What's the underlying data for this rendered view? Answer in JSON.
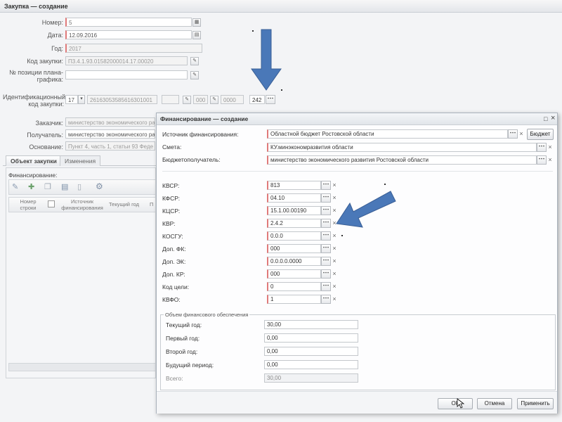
{
  "main": {
    "title": "Закупка — создание",
    "number_label": "Номер:",
    "number_value": "5",
    "date_label": "Дата:",
    "date_value": "12.09.2016",
    "year_label": "Год:",
    "year_value": "2017",
    "code_label": "Код закупки:",
    "code_value": "П3.4.1.93.01582000014.17.00020",
    "plan_pos_label_1": "№ позиции плана-",
    "plan_pos_label_2": "графика:",
    "plan_pos_value": "",
    "ident_label_1": "Идентификационный",
    "ident_label_2": "код закупки:",
    "ident_year": "17",
    "ident_code": "26163053585616301001",
    "ident_part_1": "000",
    "ident_part_2": "0000",
    "ident_part_3": "242",
    "customer_label": "Заказчик:",
    "customer_value": "министерство экономического ра",
    "recipient_label": "Получатель:",
    "recipient_value": "министерство экономического ра",
    "basis_label": "Основание:",
    "basis_value": "Пункт 4, часть 1, статьи 93 Феде",
    "tabs": [
      {
        "label": "Объект закупки"
      },
      {
        "label": "Изменения"
      }
    ],
    "financing_label": "Финансирование:",
    "grid_headers": {
      "row_num_1": "Номер",
      "row_num_2": "строки",
      "source_1": "Источник",
      "source_2": "финансирования",
      "current_year": "Текущий год",
      "next": "П"
    }
  },
  "dialog": {
    "title": "Финансирование — создание",
    "source_label": "Источник финансирования:",
    "source_value": "Областной бюджет Ростовской области",
    "budget_button": "Бюджет",
    "estimate_label": "Смета:",
    "estimate_value": "КУ.минэкономразвития области",
    "recipient_label": "Бюджетополучатель:",
    "recipient_value": "министерство экономического развития Ростовской области",
    "codes": [
      {
        "label": "КВСР:",
        "value": "813"
      },
      {
        "label": "КФСР:",
        "value": "04.10"
      },
      {
        "label": "КЦСР:",
        "value": "15.1.00.00190"
      },
      {
        "label": "КВР:",
        "value": "2.4.2"
      },
      {
        "label": "КОСГУ:",
        "value": "0.0.0"
      },
      {
        "label": "Доп. ФК:",
        "value": "000"
      },
      {
        "label": "Доп. ЭК:",
        "value": "0.0.0.0.0000"
      },
      {
        "label": "Доп. КР:",
        "value": "000"
      },
      {
        "label": "Код цели:",
        "value": "0"
      },
      {
        "label": "КВФО:",
        "value": "1"
      }
    ],
    "volume_legend": "Объем финансового обеспечения",
    "volume": [
      {
        "label": "Текущий год:",
        "value": "30,00"
      },
      {
        "label": "Первый год:",
        "value": "0,00"
      },
      {
        "label": "Второй год:",
        "value": "0,00"
      },
      {
        "label": "Будущий период:",
        "value": "0,00"
      },
      {
        "label": "Всего:",
        "value": "30,00"
      }
    ],
    "ok_button": "ОК",
    "cancel_button": "Отмена",
    "apply_button": "Применить"
  },
  "icons": {
    "pick": "⋯",
    "clear": "×",
    "dropdown": "▾",
    "calendar": "calendar-icon",
    "close": "×",
    "maximize": "□"
  },
  "colors": {
    "arrow": "#4a78b8",
    "required_border": "#e07a7a"
  }
}
